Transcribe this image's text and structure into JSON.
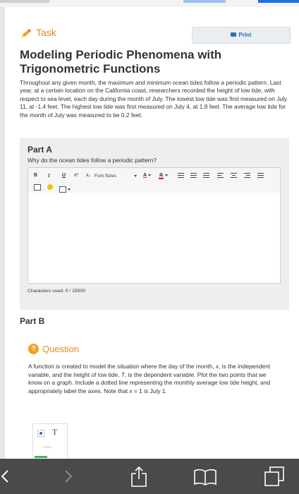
{
  "header": {
    "task_label": "Task",
    "print_label": "Print"
  },
  "title": "Modeling Periodic Phenomena with Trigonometric Functions",
  "intro": "Throughout any given month, the maximum and minimum ocean tides follow a periodic pattern. Last year, at a certain location on the California coast, researchers recorded the height of low tide, with respect to sea level, each day during the month of July. The lowest low tide was first measured on July 11, at -1.4 feet. The highest low tide was first measured on July 4, at 1.8 feet. The average low tide for the month of July was measured to be 0.2 feet.",
  "part_a": {
    "title": "Part A",
    "question": "Why do the ocean tides follow a periodic pattern?",
    "toolbar": {
      "bold": "B",
      "italic": "I",
      "underline": "U",
      "superscript": "x²",
      "subscript": "x₂",
      "font_sizes": "Font Sizes",
      "font_color": "A",
      "highlight": "A"
    },
    "editor_value": "",
    "char_count": "Characters used: 0 / 15000"
  },
  "part_b": {
    "title": "Part B",
    "question_label": "Question",
    "question_icon": "?",
    "question_text_1": "A function is created to model the situation where the day of the month, ",
    "var_x": "x",
    "question_text_2": ", is the independent variable, and the height of low tide, ",
    "var_t": "T",
    "question_text_3": ", is the dependent variable. Plot the two points that we know on a graph. Include a dotted line representing the monthly average low tide height, and appropriately label the axes. Note that ",
    "var_x2": "x",
    "question_text_4": " = 1 is July 1.",
    "tools": {
      "text_tool": "T",
      "lines_label": "Lines"
    }
  },
  "colors": {
    "accent_orange": "#e08a1e",
    "print_blue": "#2e6fb0",
    "bottom_bar": "#4a4a4a",
    "tab_blue": "#1a73e8"
  }
}
